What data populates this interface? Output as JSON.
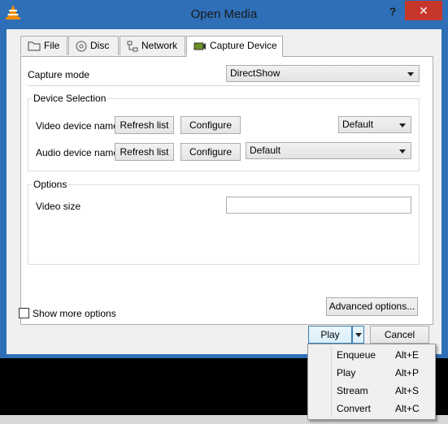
{
  "window": {
    "title": "Open Media",
    "help_glyph": "?",
    "close_glyph": "✕"
  },
  "tabs": [
    {
      "label": "File",
      "icon": "folder-icon"
    },
    {
      "label": "Disc",
      "icon": "disc-icon"
    },
    {
      "label": "Network",
      "icon": "network-icon"
    },
    {
      "label": "Capture Device",
      "icon": "capture-device-icon",
      "selected": true
    }
  ],
  "capture": {
    "mode_label": "Capture mode",
    "mode_value": "DirectShow"
  },
  "device_selection": {
    "title": "Device Selection",
    "video_label": "Video device name",
    "audio_label": "Audio device name",
    "refresh_label": "Refresh list",
    "configure_label": "Configure",
    "video_value": "Default",
    "audio_value": "Default"
  },
  "options": {
    "title": "Options",
    "video_size_label": "Video size",
    "video_size_value": ""
  },
  "advanced_label": "Advanced options...",
  "show_more_label": "Show more options",
  "play_label": "Play",
  "cancel_label": "Cancel",
  "menu": [
    {
      "label": "Enqueue",
      "shortcut": "Alt+E"
    },
    {
      "label": "Play",
      "shortcut": "Alt+P"
    },
    {
      "label": "Stream",
      "shortcut": "Alt+S"
    },
    {
      "label": "Convert",
      "shortcut": "Alt+C"
    }
  ]
}
